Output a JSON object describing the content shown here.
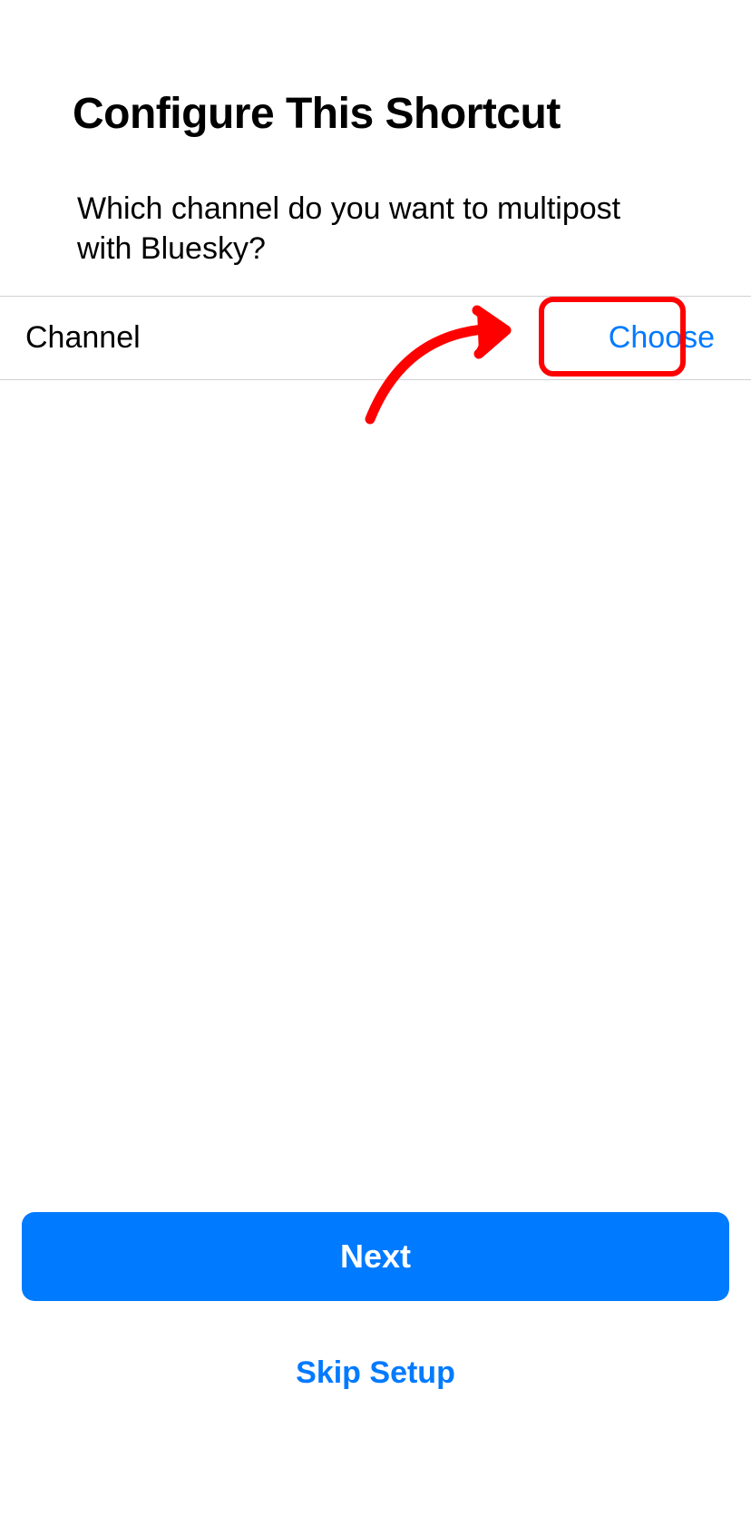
{
  "header": {
    "title": "Configure This Shortcut"
  },
  "description": {
    "text": "Which channel do you want to multipost with Bluesky?"
  },
  "row": {
    "label": "Channel",
    "action_label": "Choose"
  },
  "footer": {
    "next_label": "Next",
    "skip_label": "Skip Setup"
  },
  "annotation": {
    "highlight_color": "#ff0000",
    "arrow_color": "#ff0000"
  }
}
